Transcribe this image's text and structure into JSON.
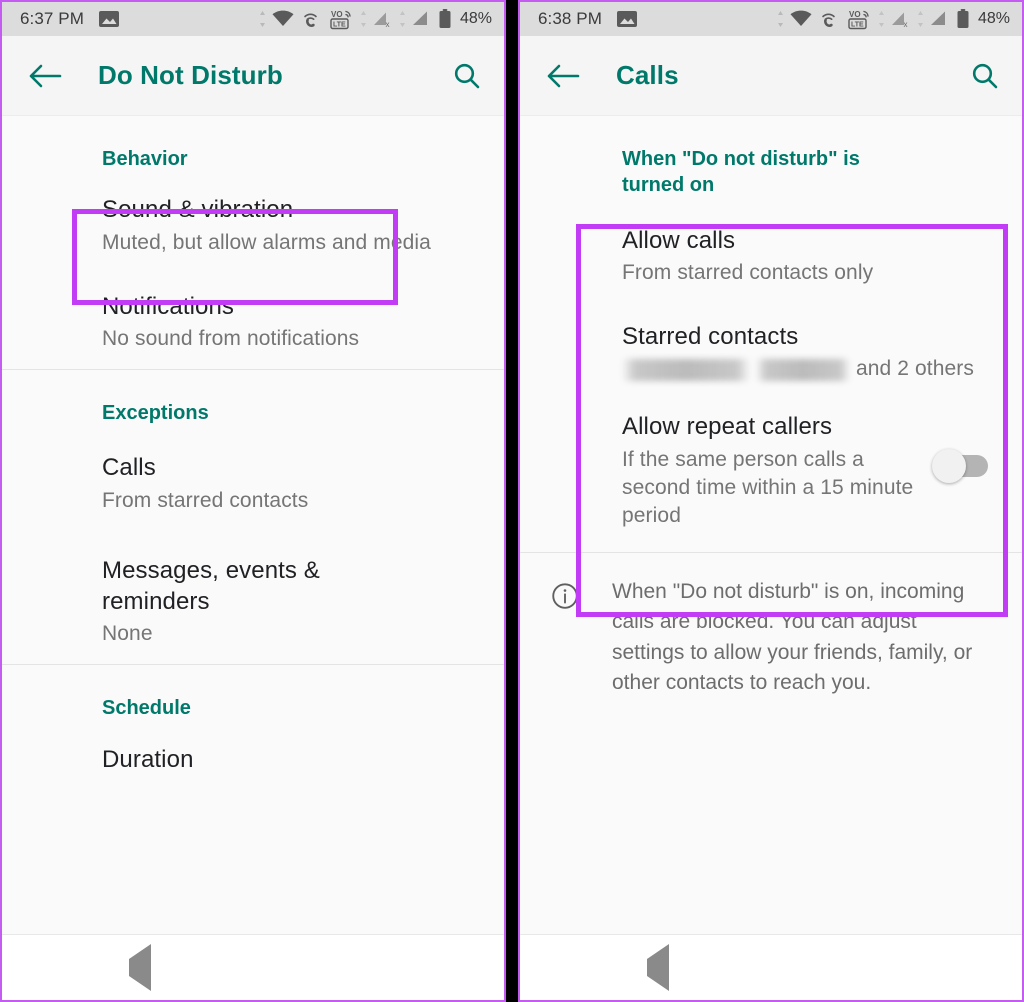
{
  "left_phone": {
    "status_bar": {
      "time": "6:37 PM",
      "battery_percent": "48%",
      "icons": [
        "image-icon",
        "wifi-icon",
        "wifi-calling-icon",
        "volte-icon",
        "signal-no-sim-icon",
        "signal-bars-icon",
        "battery-icon"
      ]
    },
    "app_bar": {
      "back_icon": "arrow-back-icon",
      "title": "Do Not Disturb",
      "search_icon": "search-icon"
    },
    "sections": [
      {
        "header": "Behavior",
        "rows": [
          {
            "title": "Sound & vibration",
            "sub": "Muted, but allow alarms and media"
          },
          {
            "title": "Notifications",
            "sub": "No sound from notifications"
          }
        ]
      },
      {
        "header": "Exceptions",
        "rows": [
          {
            "title": "Calls",
            "sub": "From starred contacts",
            "highlighted": true
          },
          {
            "title": "Messages, events & reminders",
            "sub": "None"
          }
        ]
      },
      {
        "header": "Schedule",
        "rows": [
          {
            "title": "Duration",
            "sub": ""
          }
        ]
      }
    ],
    "nav_bar": {
      "back": "nav-back-icon",
      "home": "nav-home-icon",
      "recents": "nav-recents-icon"
    }
  },
  "right_phone": {
    "status_bar": {
      "time": "6:38 PM",
      "battery_percent": "48%",
      "icons": [
        "image-icon",
        "wifi-icon",
        "wifi-calling-icon",
        "volte-icon",
        "signal-no-sim-icon",
        "signal-bars-icon",
        "battery-icon"
      ]
    },
    "app_bar": {
      "back_icon": "arrow-back-icon",
      "title": "Calls",
      "search_icon": "search-icon"
    },
    "section_header": "When \"Do not disturb\" is turned on",
    "rows": [
      {
        "title": "Allow calls",
        "sub": "From starred contacts only"
      },
      {
        "title": "Starred contacts",
        "sub_redacted": true,
        "sub_suffix": "and 2 others"
      },
      {
        "title": "Allow repeat callers",
        "sub": "If the same person calls a second time within a 15 minute period",
        "toggle": "off"
      }
    ],
    "info": {
      "icon": "info-icon",
      "text": "When \"Do not disturb\" is on, incoming calls are blocked. You can adjust settings to allow your friends, family, or other contacts to reach you."
    },
    "nav_bar": {
      "back": "nav-back-icon",
      "home": "nav-home-icon",
      "recents": "nav-recents-icon"
    }
  },
  "annotation": {
    "color": "#c13cf4",
    "boxes": [
      "left-calls-row",
      "right-allow-calls-group"
    ]
  },
  "theme": {
    "accent_teal": "#00796b",
    "highlight_purple": "#c13cf4",
    "status_bar_bg": "#dcdcdc",
    "app_bar_bg": "#f5f5f5",
    "content_bg": "#fafafa",
    "primary_text": "#202124",
    "secondary_text": "#757575"
  }
}
